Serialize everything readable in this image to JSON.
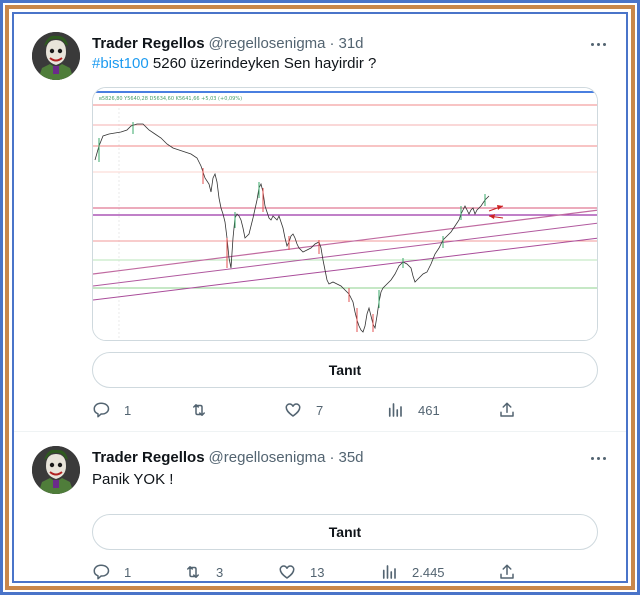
{
  "tweets": [
    {
      "author_name": "Trader Regellos",
      "author_handle": "@regellosenigma",
      "separator": "·",
      "time": "31d",
      "hashtag": "#bist100",
      "text": " 5260 üzerindeyken Sen hayirdir ?",
      "button_label": "Tanıt",
      "replies": "1",
      "retweets": "",
      "likes": "7",
      "views": "461"
    },
    {
      "author_name": "Trader Regellos",
      "author_handle": "@regellosenigma",
      "separator": "·",
      "time": "35d",
      "hashtag": "",
      "text": "Panik YOK !",
      "button_label": "Tanıt",
      "replies": "1",
      "retweets": "3",
      "likes": "13",
      "views": "2.445"
    }
  ],
  "chart_header": "ʙ5826,80  Y5640,28  D5634,60  K5641,66  +5,03 (+0,09%)",
  "icons": {
    "reply": "reply-icon",
    "retweet": "retweet-icon",
    "like": "heart-icon",
    "views": "views-icon",
    "share": "share-icon",
    "more": "more-icon"
  },
  "colors": {
    "accent": "#1d9bf0",
    "text_primary": "#0f1419",
    "text_secondary": "#536471",
    "frame_blue": "#4a74c9",
    "frame_orange": "#c9874a"
  }
}
